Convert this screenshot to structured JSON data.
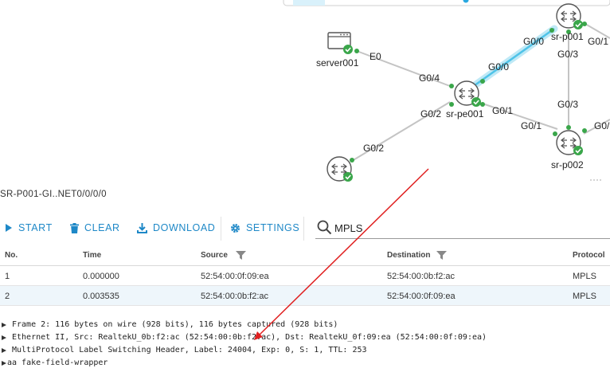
{
  "topology": {
    "nodes": {
      "server": {
        "label": "server001",
        "icon": "server-icon"
      },
      "pe": {
        "label": "sr-pe001",
        "icon": "router-icon"
      },
      "p001": {
        "label": "sr-p001",
        "icon": "router-icon"
      },
      "p002": {
        "label": "sr-p002",
        "icon": "router-icon"
      },
      "bottom": {
        "label": "",
        "icon": "router-icon"
      }
    },
    "interfaces": {
      "server_e0": "E0",
      "pe_g04": "G0/4",
      "pe_g00": "G0/0",
      "p001_g00": "G0/0",
      "pe_g01": "G0/1",
      "p002_g01": "G0/1",
      "pe_g02": "G0/2",
      "bottom_g02": "G0/2",
      "p001_g03": "G0/3",
      "p002_g03": "G0/3",
      "p002_right": "G0/",
      "p001_right": "G0/1"
    },
    "colors": {
      "link": "#c4c4c4",
      "highlight_link": "#4fc3e8",
      "highlight_glow": "#bfe9f6",
      "status_ok": "#3aa64a",
      "router": "#555555"
    }
  },
  "capture": {
    "title": "SR-P001-GI..NET0/0/0/0",
    "toolbar": {
      "start": "START",
      "clear": "CLEAR",
      "download": "DOWNLOAD",
      "settings": "SETTINGS"
    },
    "filter_value": "MPLS",
    "accent_color": "#1e88c7",
    "columns": {
      "no": "No.",
      "time": "Time",
      "source": "Source",
      "destination": "Destination",
      "protocol": "Protocol"
    },
    "packets": [
      {
        "no": "1",
        "time": "0.000000",
        "source": "52:54:00:0f:09:ea",
        "destination": "52:54:00:0b:f2:ac",
        "protocol": "MPLS"
      },
      {
        "no": "2",
        "time": "0.003535",
        "source": "52:54:00:0b:f2:ac",
        "destination": "52:54:00:0f:09:ea",
        "protocol": "MPLS"
      }
    ],
    "details": [
      "Frame 2: 116 bytes on wire (928 bits), 116 bytes captured (928 bits)",
      "Ethernet II, Src: RealtekU_0b:f2:ac (52:54:00:0b:f2:ac), Dst: RealtekU_0f:09:ea (52:54:00:0f:09:ea)",
      "MultiProtocol Label Switching Header, Label: 24004, Exp: 0, S: 1, TTL: 253",
      "aa fake-field-wrapper"
    ]
  },
  "annotation": {
    "arrow_color": "#e02020"
  }
}
